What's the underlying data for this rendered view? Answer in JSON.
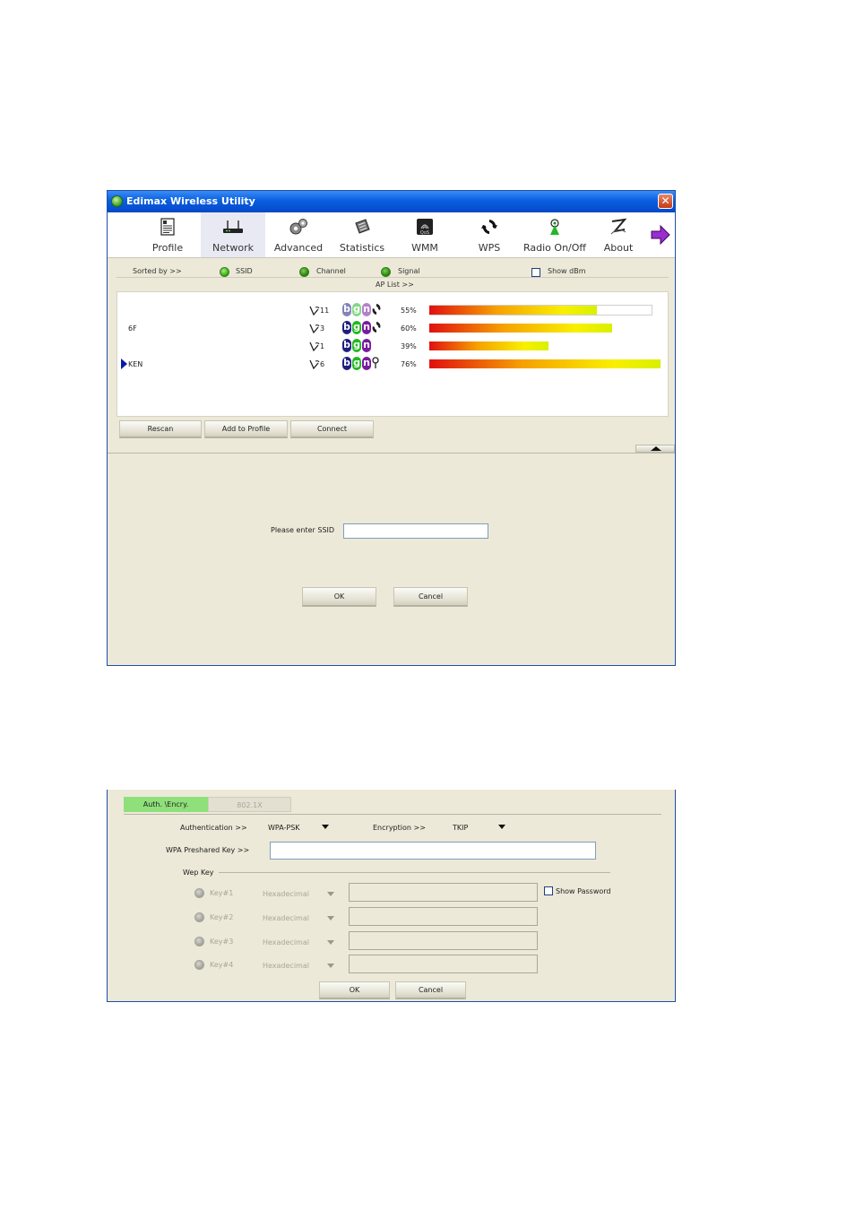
{
  "window": {
    "title": "Edimax Wireless Utility",
    "close_label": "✕"
  },
  "toolbar": {
    "items": [
      {
        "label": "Profile",
        "icon": "profile-icon"
      },
      {
        "label": "Network",
        "icon": "network-router-icon",
        "selected": true
      },
      {
        "label": "Advanced",
        "icon": "advanced-gears-icon"
      },
      {
        "label": "Statistics",
        "icon": "statistics-icon"
      },
      {
        "label": "WMM",
        "icon": "wmm-qos-icon"
      },
      {
        "label": "WPS",
        "icon": "wps-icon"
      },
      {
        "label": "Radio On/Off",
        "icon": "radio-antenna-icon"
      },
      {
        "label": "About",
        "icon": "about-icon"
      }
    ],
    "next_icon": "next-arrow-icon"
  },
  "sort": {
    "label": "Sorted by >>",
    "ssid": "SSID",
    "channel": "Channel",
    "signal": "Signal",
    "show_dbm": "Show dBm",
    "ap_list": "AP List >>"
  },
  "ap_list": [
    {
      "ssid": "",
      "channel": "11",
      "modes": [
        "b",
        "g",
        "n"
      ],
      "wps": true,
      "key": false,
      "signal_text": "55%",
      "signal_fraction": 0.55,
      "selected": false,
      "highlighted": true
    },
    {
      "ssid": "6F",
      "channel": "3",
      "modes": [
        "b",
        "g",
        "n"
      ],
      "wps": true,
      "key": false,
      "signal_text": "60%",
      "signal_fraction": 0.6,
      "selected": false,
      "highlighted": false
    },
    {
      "ssid": "",
      "channel": "1",
      "modes": [
        "b",
        "g",
        "n"
      ],
      "wps": false,
      "key": false,
      "signal_text": "39%",
      "signal_fraction": 0.39,
      "selected": false,
      "highlighted": false
    },
    {
      "ssid": "KEN",
      "channel": "6",
      "modes": [
        "b",
        "g",
        "n"
      ],
      "wps": false,
      "key": true,
      "signal_text": "76%",
      "signal_fraction": 0.76,
      "selected": true,
      "highlighted": false
    }
  ],
  "buttons": {
    "rescan": "Rescan",
    "add_to_profile": "Add to Profile",
    "connect": "Connect"
  },
  "ssid_form": {
    "label": "Please enter SSID",
    "value": "",
    "ok": "OK",
    "cancel": "Cancel"
  },
  "security": {
    "tabs": [
      "Auth. \\Encry.",
      "802.1X"
    ],
    "auth_label": "Authentication >>",
    "auth_value": "WPA-PSK",
    "enc_label": "Encryption >>",
    "enc_value": "TKIP",
    "psk_label": "WPA Preshared Key >>",
    "psk_value": "",
    "wep_group": "Wep Key",
    "keys": [
      {
        "label": "Key#1",
        "format": "Hexadecimal"
      },
      {
        "label": "Key#2",
        "format": "Hexadecimal"
      },
      {
        "label": "Key#3",
        "format": "Hexadecimal"
      },
      {
        "label": "Key#4",
        "format": "Hexadecimal"
      }
    ],
    "show_password": "Show Password",
    "ok": "OK",
    "cancel": "Cancel"
  },
  "colors": {
    "badge_b": "#1f1f80",
    "badge_g": "#22b822",
    "badge_n": "#7a1aa0",
    "tab_active": "#8fe07a"
  }
}
